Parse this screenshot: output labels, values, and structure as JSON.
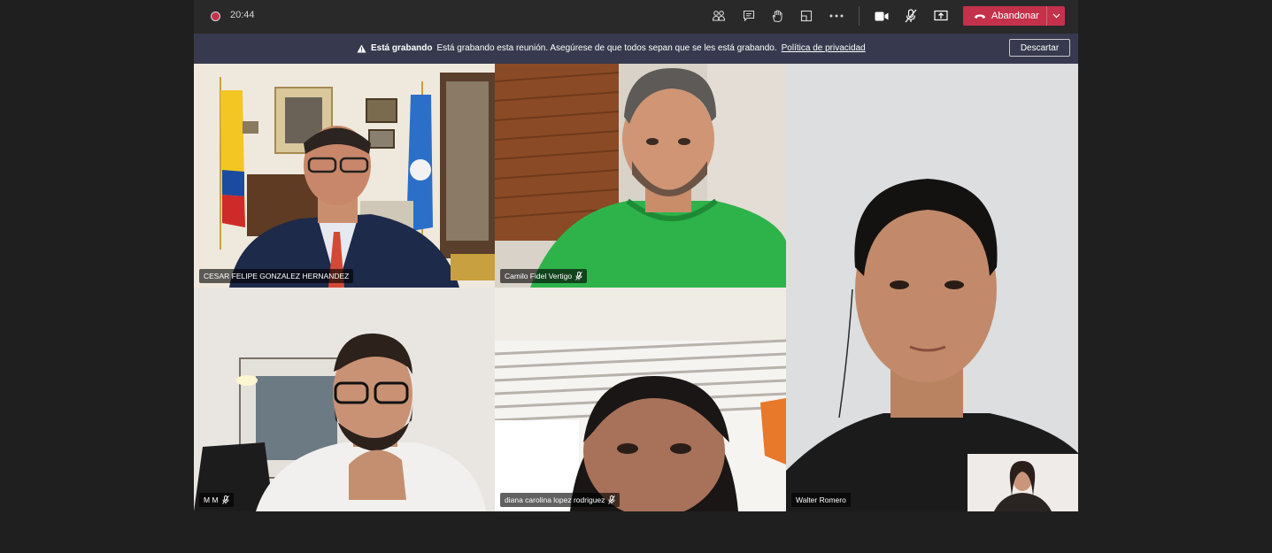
{
  "toolbar": {
    "recording_time": "20:44",
    "leave_label": "Abandonar",
    "icons": [
      "participants-icon",
      "chat-icon",
      "raise-hand-icon",
      "share-tray-icon",
      "more-icon",
      "camera-icon",
      "mic-muted-icon",
      "share-screen-icon"
    ]
  },
  "banner": {
    "title": "Está grabando",
    "message": "Está grabando esta reunión. Asegúrese de que todos sepan que se les está grabando.",
    "link": "Política de privacidad",
    "dismiss_label": "Descartar"
  },
  "participants": [
    {
      "name": "CESAR FELIPE GONZALEZ HERNANDEZ",
      "muted": false
    },
    {
      "name": "Camilo Fidel Vertigo",
      "muted": true
    },
    {
      "name": "Walter Romero",
      "muted": false
    },
    {
      "name": "M M",
      "muted": true
    },
    {
      "name": "diana carolina lopez rodriguez",
      "muted": true
    }
  ],
  "colors": {
    "background": "#1f1f1f",
    "toolbar": "#292929",
    "banner": "#373a4e",
    "leave_button": "#c4314b",
    "recording_dot": "#c4314b"
  }
}
